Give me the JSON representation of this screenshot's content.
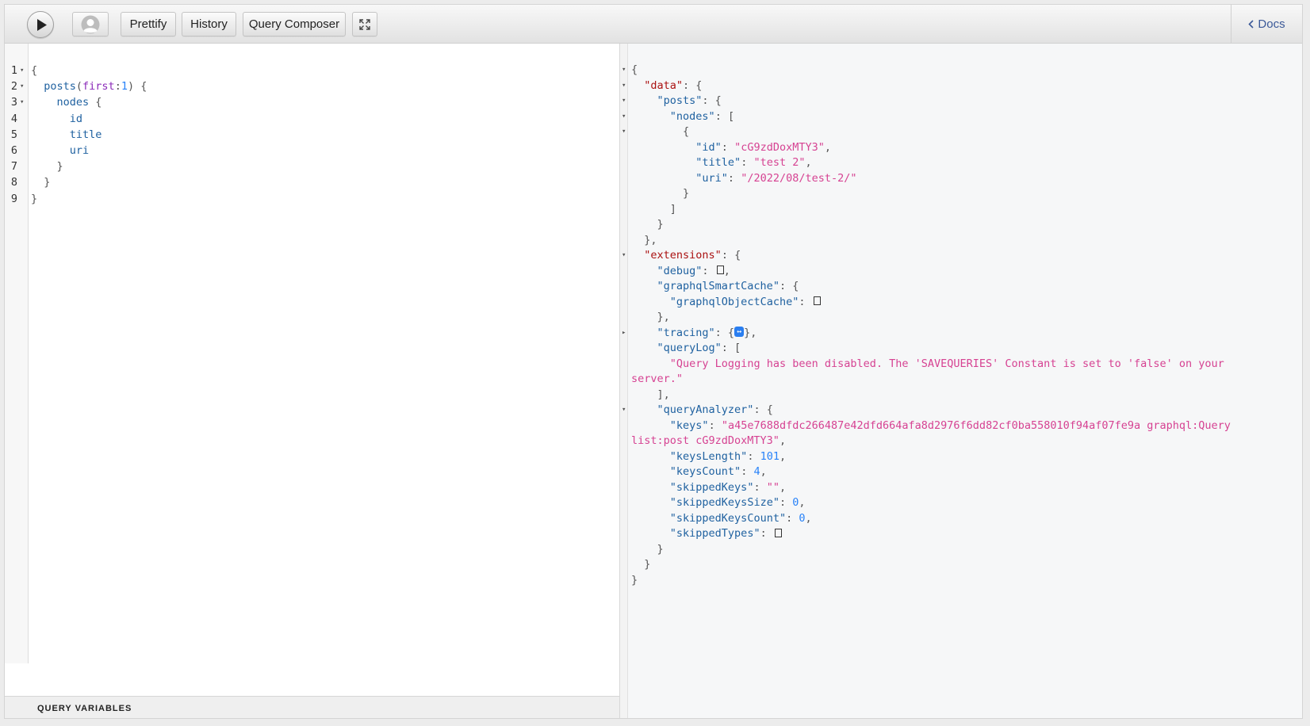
{
  "toolbar": {
    "run_icon": "play-icon",
    "avatar_icon": "user-avatar-icon",
    "prettify_label": "Prettify",
    "history_label": "History",
    "composer_label": "Query Composer",
    "fullscreen_icon": "fullscreen-icon",
    "docs_label": "Docs",
    "docs_icon": "chevron-left-icon"
  },
  "editor": {
    "lines": [
      {
        "num": "1",
        "parts": [
          {
            "t": "{",
            "c": "p"
          }
        ],
        "fold": true
      },
      {
        "num": "2",
        "parts": [
          {
            "t": "  posts",
            "c": "k"
          },
          {
            "t": "(",
            "c": "p"
          },
          {
            "t": "first",
            "c": "arg"
          },
          {
            "t": ":",
            "c": "p"
          },
          {
            "t": "1",
            "c": "num2"
          },
          {
            "t": ") {",
            "c": "p"
          }
        ],
        "fold": true
      },
      {
        "num": "3",
        "parts": [
          {
            "t": "    nodes",
            "c": "k"
          },
          {
            "t": " {",
            "c": "p"
          }
        ],
        "fold": true
      },
      {
        "num": "4",
        "parts": [
          {
            "t": "      id",
            "c": "k"
          }
        ],
        "fold": false
      },
      {
        "num": "5",
        "parts": [
          {
            "t": "      title",
            "c": "k"
          }
        ],
        "fold": false
      },
      {
        "num": "6",
        "parts": [
          {
            "t": "      uri",
            "c": "k"
          }
        ],
        "fold": false
      },
      {
        "num": "7",
        "parts": [
          {
            "t": "    }",
            "c": "p"
          }
        ],
        "fold": false
      },
      {
        "num": "8",
        "parts": [
          {
            "t": "  }",
            "c": "p"
          }
        ],
        "fold": false
      },
      {
        "num": "9",
        "parts": [
          {
            "t": "}",
            "c": "p"
          }
        ],
        "fold": false
      }
    ],
    "variables_label": "QUERY VARIABLES"
  },
  "result": {
    "lines": [
      {
        "fold": "down",
        "parts": [
          {
            "t": "{",
            "c": "p"
          }
        ]
      },
      {
        "fold": "down",
        "parts": [
          {
            "t": "  ",
            "c": "p"
          },
          {
            "t": "\"data\"",
            "c": "ek"
          },
          {
            "t": ": {",
            "c": "p"
          }
        ]
      },
      {
        "fold": "down",
        "parts": [
          {
            "t": "    ",
            "c": "p"
          },
          {
            "t": "\"posts\"",
            "c": "q"
          },
          {
            "t": ": {",
            "c": "p"
          }
        ]
      },
      {
        "fold": "down",
        "parts": [
          {
            "t": "      ",
            "c": "p"
          },
          {
            "t": "\"nodes\"",
            "c": "q"
          },
          {
            "t": ": [",
            "c": "p"
          }
        ]
      },
      {
        "fold": "down",
        "parts": [
          {
            "t": "        {",
            "c": "p"
          }
        ]
      },
      {
        "fold": "",
        "parts": [
          {
            "t": "          ",
            "c": "p"
          },
          {
            "t": "\"id\"",
            "c": "q"
          },
          {
            "t": ": ",
            "c": "p"
          },
          {
            "t": "\"cG9zdDoxMTY3\"",
            "c": "s"
          },
          {
            "t": ",",
            "c": "p"
          }
        ]
      },
      {
        "fold": "",
        "parts": [
          {
            "t": "          ",
            "c": "p"
          },
          {
            "t": "\"title\"",
            "c": "q"
          },
          {
            "t": ": ",
            "c": "p"
          },
          {
            "t": "\"test 2\"",
            "c": "s"
          },
          {
            "t": ",",
            "c": "p"
          }
        ]
      },
      {
        "fold": "",
        "parts": [
          {
            "t": "          ",
            "c": "p"
          },
          {
            "t": "\"uri\"",
            "c": "q"
          },
          {
            "t": ": ",
            "c": "p"
          },
          {
            "t": "\"/2022/08/test-2/\"",
            "c": "s"
          }
        ]
      },
      {
        "fold": "",
        "parts": [
          {
            "t": "        }",
            "c": "p"
          }
        ]
      },
      {
        "fold": "",
        "parts": [
          {
            "t": "      ]",
            "c": "p"
          }
        ]
      },
      {
        "fold": "",
        "parts": [
          {
            "t": "    }",
            "c": "p"
          }
        ]
      },
      {
        "fold": "",
        "parts": [
          {
            "t": "  },",
            "c": "p"
          }
        ]
      },
      {
        "fold": "down",
        "parts": [
          {
            "t": "  ",
            "c": "p"
          },
          {
            "t": "\"extensions\"",
            "c": "ek"
          },
          {
            "t": ": {",
            "c": "p"
          }
        ]
      },
      {
        "fold": "",
        "parts": [
          {
            "t": "    ",
            "c": "p"
          },
          {
            "t": "\"debug\"",
            "c": "q"
          },
          {
            "t": ": ",
            "c": "p"
          },
          {
            "t": "BOX",
            "c": "box"
          },
          {
            "t": ",",
            "c": "p"
          }
        ]
      },
      {
        "fold": "",
        "parts": [
          {
            "t": "    ",
            "c": "p"
          },
          {
            "t": "\"graphqlSmartCache\"",
            "c": "q"
          },
          {
            "t": ": {",
            "c": "p"
          }
        ]
      },
      {
        "fold": "",
        "parts": [
          {
            "t": "      ",
            "c": "p"
          },
          {
            "t": "\"graphqlObjectCache\"",
            "c": "q"
          },
          {
            "t": ": ",
            "c": "p"
          },
          {
            "t": "BOX",
            "c": "box"
          }
        ]
      },
      {
        "fold": "",
        "parts": [
          {
            "t": "    },",
            "c": "p"
          }
        ]
      },
      {
        "fold": "right",
        "parts": [
          {
            "t": "    ",
            "c": "p"
          },
          {
            "t": "\"tracing\"",
            "c": "q"
          },
          {
            "t": ": {",
            "c": "p"
          },
          {
            "t": "↔",
            "c": "badge"
          },
          {
            "t": "},",
            "c": "p"
          }
        ]
      },
      {
        "fold": "",
        "parts": [
          {
            "t": "    ",
            "c": "p"
          },
          {
            "t": "\"queryLog\"",
            "c": "q"
          },
          {
            "t": ": [",
            "c": "p"
          }
        ]
      },
      {
        "fold": "",
        "parts": [
          {
            "t": "      ",
            "c": "p"
          },
          {
            "t": "\"Query Logging has been disabled. The 'SAVEQUERIES' Constant is set to 'false' on your",
            "c": "s"
          }
        ]
      },
      {
        "fold": "",
        "parts": [
          {
            "t": "server.\"",
            "c": "s"
          }
        ]
      },
      {
        "fold": "",
        "parts": [
          {
            "t": "    ],",
            "c": "p"
          }
        ]
      },
      {
        "fold": "down",
        "parts": [
          {
            "t": "    ",
            "c": "p"
          },
          {
            "t": "\"queryAnalyzer\"",
            "c": "q"
          },
          {
            "t": ": {",
            "c": "p"
          }
        ]
      },
      {
        "fold": "",
        "parts": [
          {
            "t": "      ",
            "c": "p"
          },
          {
            "t": "\"keys\"",
            "c": "q"
          },
          {
            "t": ": ",
            "c": "p"
          },
          {
            "t": "\"a45e7688dfdc266487e42dfd664afa8d2976f6dd82cf0ba558010f94af07fe9a graphql:Query",
            "c": "s"
          }
        ]
      },
      {
        "fold": "",
        "parts": [
          {
            "t": "list:post cG9zdDoxMTY3\"",
            "c": "s"
          },
          {
            "t": ",",
            "c": "p"
          }
        ]
      },
      {
        "fold": "",
        "parts": [
          {
            "t": "      ",
            "c": "p"
          },
          {
            "t": "\"keysLength\"",
            "c": "q"
          },
          {
            "t": ": ",
            "c": "p"
          },
          {
            "t": "101",
            "c": "n"
          },
          {
            "t": ",",
            "c": "p"
          }
        ]
      },
      {
        "fold": "",
        "parts": [
          {
            "t": "      ",
            "c": "p"
          },
          {
            "t": "\"keysCount\"",
            "c": "q"
          },
          {
            "t": ": ",
            "c": "p"
          },
          {
            "t": "4",
            "c": "n"
          },
          {
            "t": ",",
            "c": "p"
          }
        ]
      },
      {
        "fold": "",
        "parts": [
          {
            "t": "      ",
            "c": "p"
          },
          {
            "t": "\"skippedKeys\"",
            "c": "q"
          },
          {
            "t": ": ",
            "c": "p"
          },
          {
            "t": "\"\"",
            "c": "s"
          },
          {
            "t": ",",
            "c": "p"
          }
        ]
      },
      {
        "fold": "",
        "parts": [
          {
            "t": "      ",
            "c": "p"
          },
          {
            "t": "\"skippedKeysSize\"",
            "c": "q"
          },
          {
            "t": ": ",
            "c": "p"
          },
          {
            "t": "0",
            "c": "n"
          },
          {
            "t": ",",
            "c": "p"
          }
        ]
      },
      {
        "fold": "",
        "parts": [
          {
            "t": "      ",
            "c": "p"
          },
          {
            "t": "\"skippedKeysCount\"",
            "c": "q"
          },
          {
            "t": ": ",
            "c": "p"
          },
          {
            "t": "0",
            "c": "n"
          },
          {
            "t": ",",
            "c": "p"
          }
        ]
      },
      {
        "fold": "",
        "parts": [
          {
            "t": "      ",
            "c": "p"
          },
          {
            "t": "\"skippedTypes\"",
            "c": "q"
          },
          {
            "t": ": ",
            "c": "p"
          },
          {
            "t": "BOX",
            "c": "box"
          }
        ]
      },
      {
        "fold": "",
        "parts": [
          {
            "t": "    }",
            "c": "p"
          }
        ]
      },
      {
        "fold": "",
        "parts": [
          {
            "t": "  }",
            "c": "p"
          }
        ]
      },
      {
        "fold": "",
        "parts": [
          {
            "t": "}",
            "c": "p"
          }
        ]
      }
    ]
  },
  "colors": {
    "accent": "#3b5998",
    "string": "#d64292",
    "number": "#2882f9",
    "key": "#1f61a0",
    "top_key": "#a11111"
  }
}
